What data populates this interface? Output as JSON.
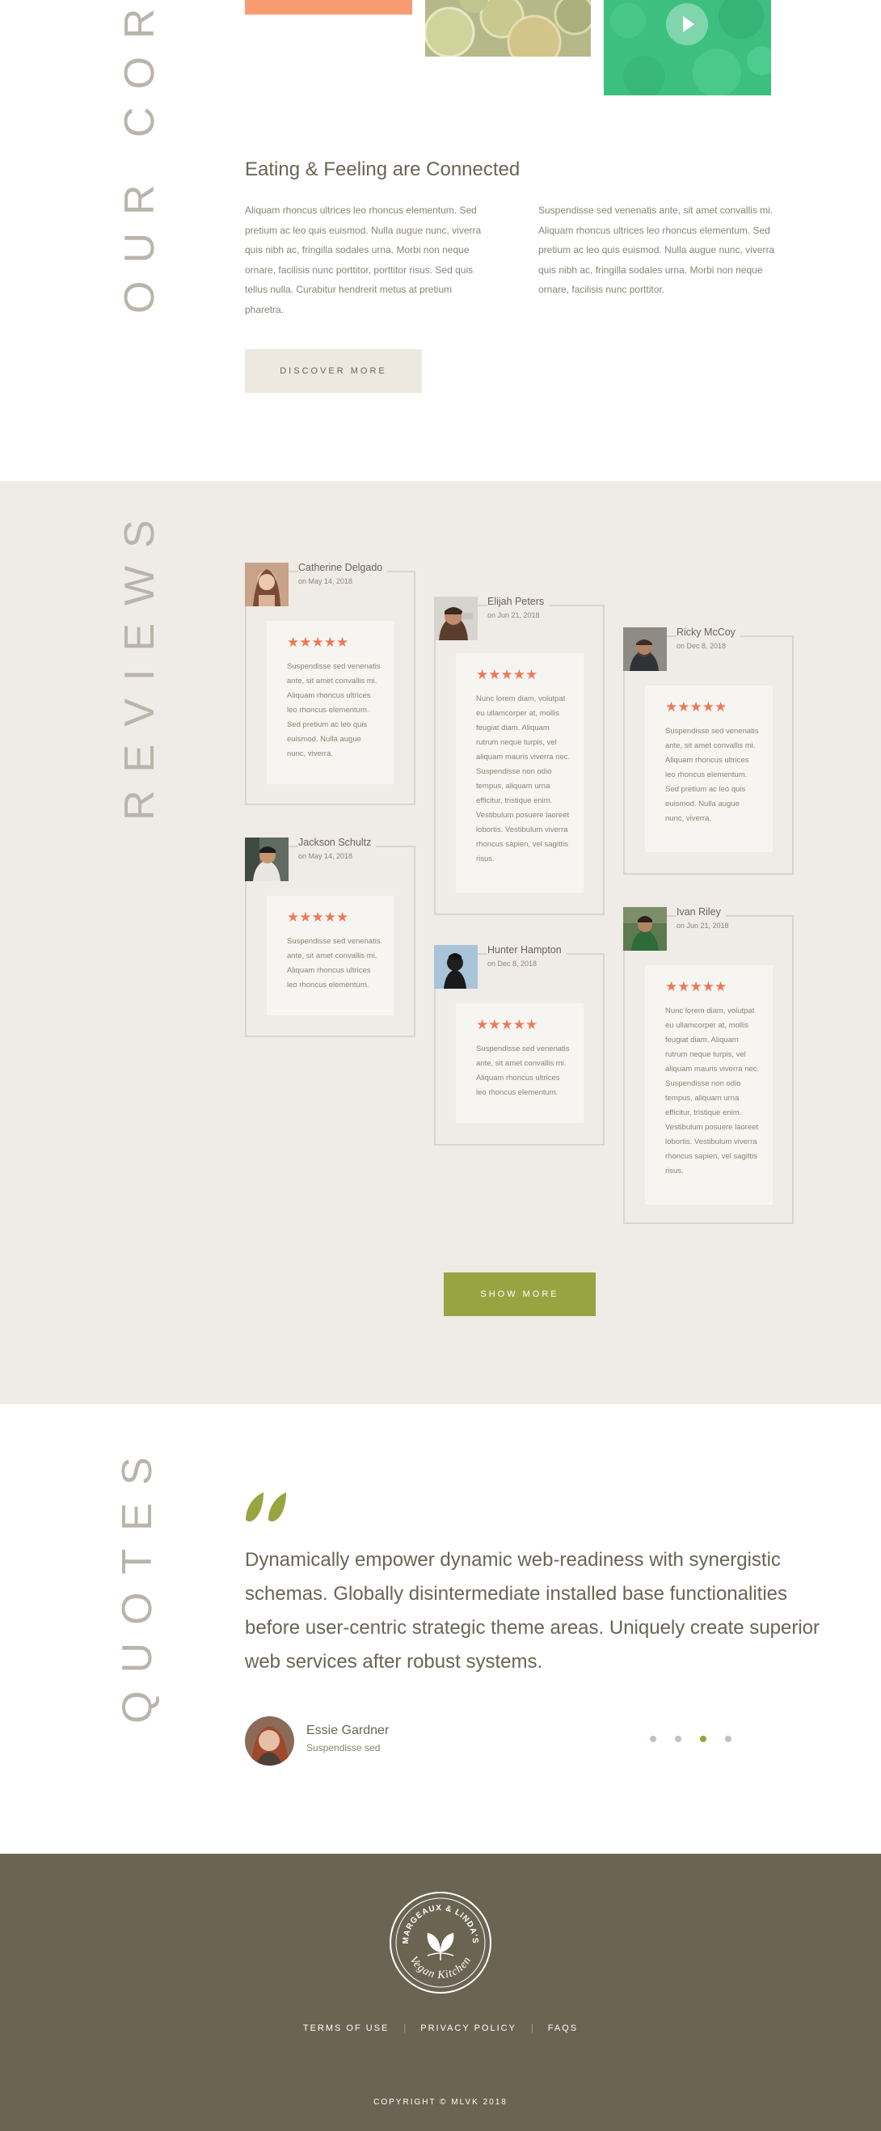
{
  "core": {
    "vertical_title": "OUR CORE",
    "heading": "Eating & Feeling are Connected",
    "col1": "Aliquam rhoncus ultrices leo rhoncus elementum. Sed pretium ac leo quis euismod. Nulla augue nunc, viverra quis nibh ac, fringilla sodales urna. Morbi non neque ornare, facilisis nunc porttitor, porttitor risus. Sed quis tellus nulla. Curabitur hendrerit metus at pretium pharetra.",
    "col2": "Suspendisse sed venenatis ante, sit amet convallis mi. Aliquam rhoncus ultrices leo rhoncus elementum. Sed pretium ac leo quis euismod. Nulla augue nunc, viverra quis nibh ac, fringilla sodales urna. Morbi non neque ornare, facilisis nunc porttitor.",
    "discover_label": "DISCOVER MORE"
  },
  "reviews": {
    "vertical_title": "REVIEWS",
    "items": [
      {
        "name": "Catherine Delgado",
        "date": "on May 14, 2018",
        "stars": "★★★★★",
        "text": "Suspendisse sed venenatis ante, sit amet convallis mi. Aliquam rhoncus ultrices leo rhoncus elementum. Sed pretium ac leo quis euismod. Nulla augue nunc, viverra."
      },
      {
        "name": "Elijah Peters",
        "date": "on Jun 21, 2018",
        "stars": "★★★★★",
        "text": "Nunc lorem diam, volutpat eu ullamcorper at, mollis feugiat diam. Aliquam rutrum neque turpis, vel aliquam mauris viverra nec. Suspendisse non odio tempus, aliquam urna efficitur, tristique enim. Vestibulum posuere laoreet lobortis. Vestibulum viverra rhoncus sapien, vel sagittis risus."
      },
      {
        "name": "Ricky McCoy",
        "date": "on Dec 8, 2018",
        "stars": "★★★★★",
        "text": "Suspendisse sed venenatis ante, sit amet convallis mi. Aliquam rhoncus ultrices leo rhoncus elementum. Sed pretium ac leo quis euismod. Nulla augue nunc, viverra."
      },
      {
        "name": "Jackson Schultz",
        "date": "on May 14, 2018",
        "stars": "★★★★★",
        "text": "Suspendisse sed venenatis ante, sit amet convallis mi. Aliquam rhoncus ultrices leo rhoncus elementum."
      },
      {
        "name": "Hunter Hampton",
        "date": "on Dec 8, 2018",
        "stars": "★★★★★",
        "text": "Suspendisse sed venenatis ante, sit amet convallis mi. Aliquam rhoncus ultrices leo rhoncus elementum."
      },
      {
        "name": "Ivan Riley",
        "date": "on Jun 21, 2018",
        "stars": "★★★★★",
        "text": "Nunc lorem diam, volutpat eu ullamcorper at, mollis feugiat diam. Aliquam rutrum neque turpis, vel aliquam mauris viverra nec. Suspendisse non odio tempus, aliquam urna efficitur, tristique enim. Vestibulum posuere laoreet lobortis. Vestibulum viverra rhoncus sapien, vel sagittis risus."
      }
    ],
    "show_more_label": "SHOW MORE"
  },
  "quotes": {
    "vertical_title": "QUOTES",
    "text": "Dynamically empower dynamic web-readiness with synergistic schemas. Globally disintermediate installed base functionalities before user-centric strategic theme areas. Uniquely create superior web services after robust systems.",
    "author_name": "Essie Gardner",
    "author_role": "Suspendisse sed",
    "active_dot": 3
  },
  "footer": {
    "logo_top": "MARGEAUX & LINDA'S",
    "logo_bottom": "Vegan Kitchen",
    "links": [
      "TERMS OF USE",
      "PRIVACY POLICY",
      "FAQS"
    ],
    "separator": "|",
    "copyright": "COPYRIGHT © MLVK 2018"
  },
  "colors": {
    "accent_green": "#98a441",
    "star_orange": "#ec7a5a",
    "footer_bg": "#6b6453",
    "reviews_bg": "#efebe6"
  }
}
